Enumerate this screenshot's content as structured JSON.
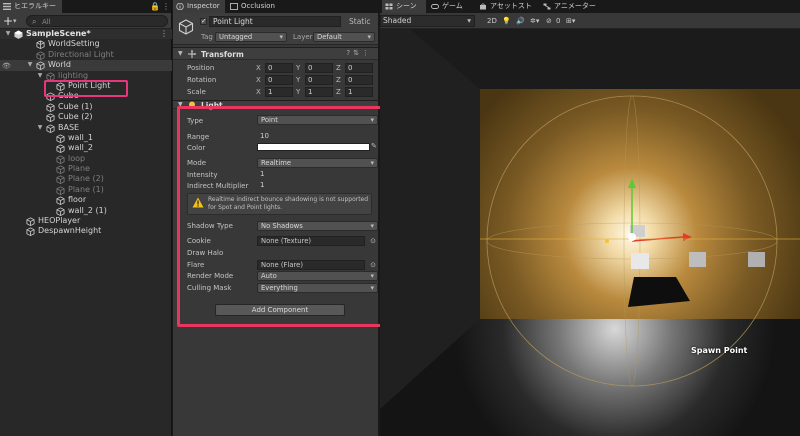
{
  "hierarchy": {
    "tab_label": "ヒエラルキー",
    "search_placeholder": "All",
    "items": [
      {
        "label": "SampleScene*"
      },
      {
        "label": "WorldSetting"
      },
      {
        "label": "Directional Light"
      },
      {
        "label": "World"
      },
      {
        "label": "lighting"
      },
      {
        "label": "Point Light"
      },
      {
        "label": "Cube"
      },
      {
        "label": "Cube (1)"
      },
      {
        "label": "Cube (2)"
      },
      {
        "label": "BASE"
      },
      {
        "label": "wall_1"
      },
      {
        "label": "wall_2"
      },
      {
        "label": "loop"
      },
      {
        "label": "Plane"
      },
      {
        "label": "Plane (2)"
      },
      {
        "label": "Plane (1)"
      },
      {
        "label": "floor"
      },
      {
        "label": "wall_2 (1)"
      },
      {
        "label": "HEOPlayer"
      },
      {
        "label": "DespawnHeight"
      }
    ]
  },
  "inspector": {
    "tab_inspector": "Inspector",
    "tab_occlusion": "Occlusion",
    "object_name": "Point Light",
    "static_label": "Static",
    "tag_label": "Tag",
    "tag_value": "Untagged",
    "layer_label": "Layer",
    "layer_value": "Default",
    "transform": {
      "title": "Transform",
      "position_label": "Position",
      "rotation_label": "Rotation",
      "scale_label": "Scale",
      "position": [
        "0",
        "0",
        "0"
      ],
      "rotation": [
        "0",
        "0",
        "0"
      ],
      "scale": [
        "1",
        "1",
        "1"
      ],
      "axis_x": "X",
      "axis_y": "Y",
      "axis_z": "Z"
    },
    "light": {
      "title": "Light",
      "type_label": "Type",
      "type_value": "Point",
      "range_label": "Range",
      "range_value": "10",
      "color_label": "Color",
      "color_value": "#ffffff",
      "mode_label": "Mode",
      "mode_value": "Realtime",
      "intensity_label": "Intensity",
      "intensity_value": "1",
      "indirect_label": "Indirect Multiplier",
      "indirect_value": "1",
      "warning": "Realtime indirect bounce shadowing is not supported for Spot and Point lights.",
      "shadow_label": "Shadow Type",
      "shadow_value": "No Shadows",
      "cookie_label": "Cookie",
      "cookie_value": "None (Texture)",
      "halo_label": "Draw Halo",
      "flare_label": "Flare",
      "flare_value": "None (Flare)",
      "render_mode_label": "Render Mode",
      "render_mode_value": "Auto",
      "culling_label": "Culling Mask",
      "culling_value": "Everything"
    },
    "add_component": "Add Component"
  },
  "scene": {
    "tab_scene": "シーン",
    "tab_game": "ゲーム",
    "tab_assetstore": "アセットストア",
    "tab_animator": "アニメーター",
    "shading_mode": "Shaded",
    "mode_2d": "2D",
    "hidden_count": "0",
    "spawn_label": "Spawn Point"
  },
  "colors": {
    "highlight_pink": "#e8367a",
    "highlight_red": "#e8365f",
    "light_gizmo": "#f0c040",
    "axis_x": "#e03c2a",
    "axis_y": "#5ec836"
  }
}
